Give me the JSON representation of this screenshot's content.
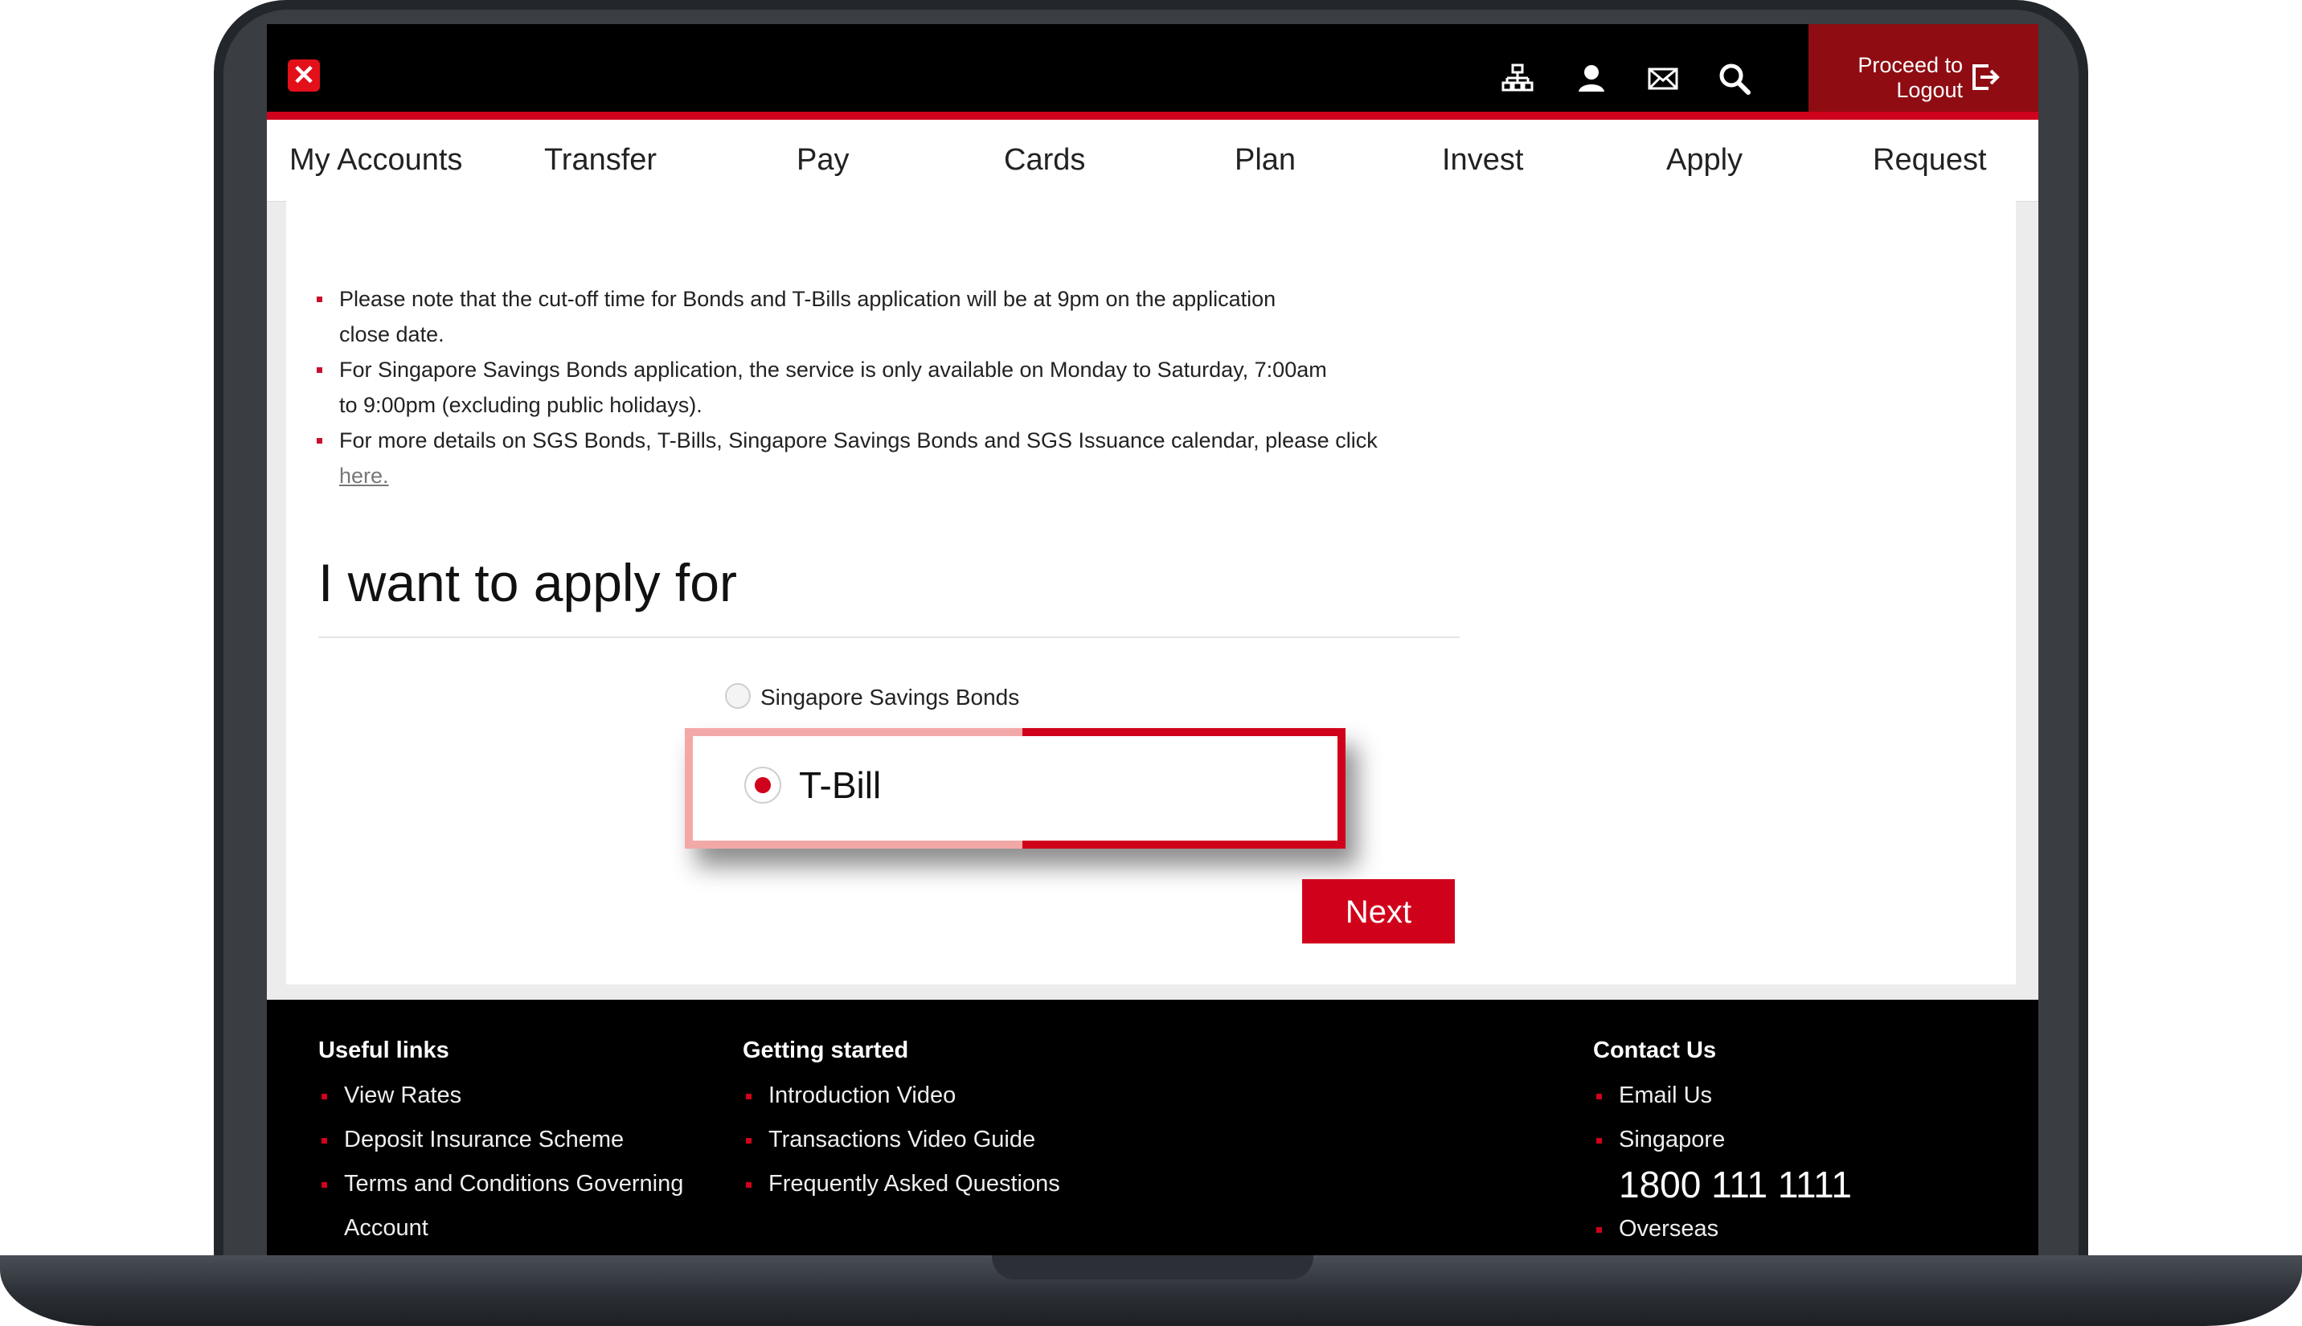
{
  "header": {
    "logout_line1": "Proceed to",
    "logout_line2": "Logout",
    "icons": [
      "sitemap-icon",
      "user-icon",
      "mail-icon",
      "search-icon",
      "logout-icon"
    ],
    "brand_color": "#d0021b"
  },
  "nav": {
    "items": [
      "My Accounts",
      "Transfer",
      "Pay",
      "Cards",
      "Plan",
      "Invest",
      "Apply",
      "Request"
    ]
  },
  "notes": {
    "b1_line1": "Please note that the cut-off time for Bonds and T-Bills application will be at 9pm on the application",
    "b1_line2": "close date.",
    "b2_line1": "For Singapore Savings Bonds application, the service is only available on Monday to Saturday, 7:00am",
    "b2_line2": "to 9:00pm (excluding public holidays).",
    "b3_line1": "For more details on SGS Bonds, T-Bills, Singapore Savings Bonds and SGS Issuance calendar, please click",
    "b3_link": "here."
  },
  "form": {
    "heading": "I want to apply for",
    "option1": "Singapore Savings Bonds",
    "option2": "T-Bill",
    "selected": "T-Bill",
    "next": "Next"
  },
  "footer": {
    "useful_title": "Useful links",
    "useful": [
      "View Rates",
      "Deposit Insurance Scheme",
      "Terms and Conditions Governing"
    ],
    "useful_cont": "Account",
    "started_title": "Getting started",
    "started": [
      "Introduction Video",
      "Transactions Video Guide",
      "Frequently Asked Questions"
    ],
    "contact_title": "Contact Us",
    "contact_email": "Email Us",
    "contact_sg": "Singapore",
    "contact_phone": "1800 111 1111",
    "contact_overseas": "Overseas"
  }
}
